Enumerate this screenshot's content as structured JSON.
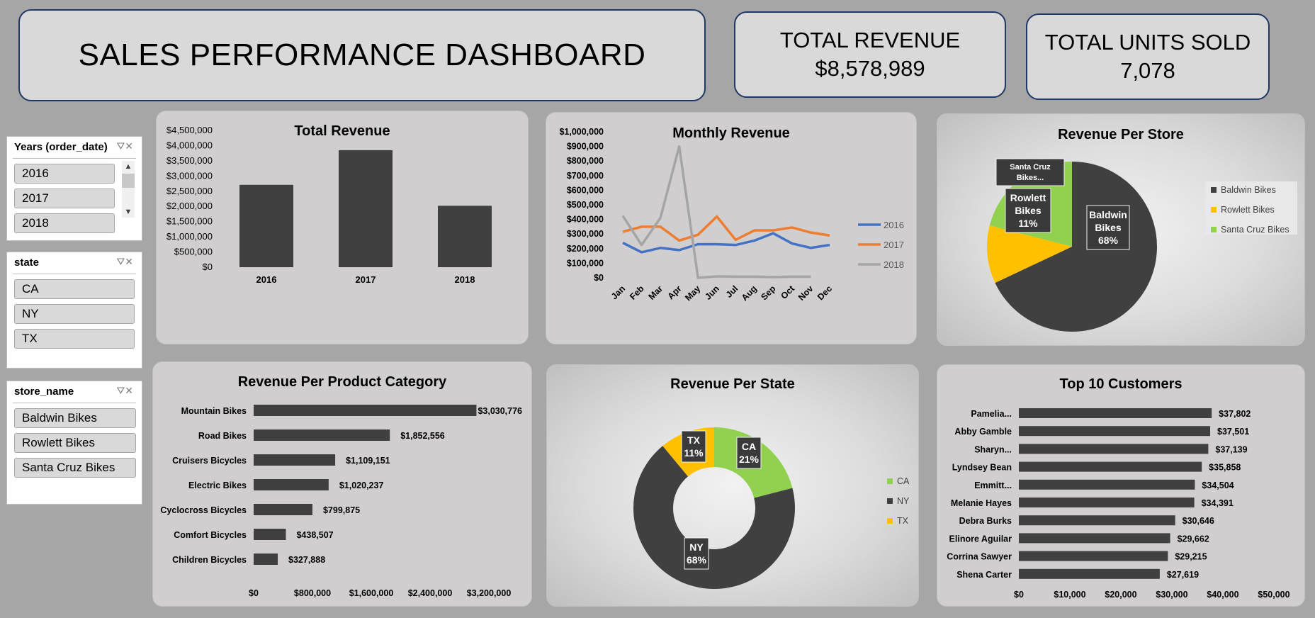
{
  "header": {
    "title": "SALES PERFORMANCE DASHBOARD",
    "kpis": [
      {
        "label": "TOTAL REVENUE",
        "value": "$8,578,989"
      },
      {
        "label": "TOTAL UNITS SOLD",
        "value": "7,078"
      }
    ]
  },
  "slicers": {
    "years": {
      "title": "Years (order_date)",
      "items": [
        "2016",
        "2017",
        "2018"
      ]
    },
    "state": {
      "title": "state",
      "items": [
        "CA",
        "NY",
        "TX"
      ]
    },
    "store": {
      "title": "store_name",
      "items": [
        "Baldwin Bikes",
        "Rowlett Bikes",
        "Santa Cruz Bikes"
      ]
    }
  },
  "colors": {
    "dark": "#404040",
    "blue": "#4472c4",
    "orange": "#ed7d31",
    "gray": "#a5a5a5",
    "green": "#92d050",
    "yellow": "#ffc000"
  },
  "chart_data": [
    {
      "id": "total-revenue",
      "type": "bar",
      "title": "Total Revenue",
      "categories": [
        "2016",
        "2017",
        "2018"
      ],
      "values": [
        2710000,
        3850000,
        2020000
      ],
      "ylim": [
        0,
        4500000
      ],
      "yticks": [
        "$0",
        "$500,000",
        "$1,000,000",
        "$1,500,000",
        "$2,000,000",
        "$2,500,000",
        "$3,000,000",
        "$3,500,000",
        "$4,000,000",
        "$4,500,000"
      ],
      "grid": false
    },
    {
      "id": "monthly-revenue",
      "type": "line",
      "title": "Monthly Revenue",
      "categories": [
        "Jan",
        "Feb",
        "Mar",
        "Apr",
        "May",
        "Jun",
        "Jul",
        "Aug",
        "Sep",
        "Oct",
        "Nov",
        "Dec"
      ],
      "series": [
        {
          "name": "2016",
          "values": [
            240000,
            175000,
            205000,
            190000,
            230000,
            230000,
            225000,
            255000,
            305000,
            235000,
            205000,
            225000
          ]
        },
        {
          "name": "2017",
          "values": [
            315000,
            350000,
            350000,
            255000,
            295000,
            420000,
            260000,
            325000,
            325000,
            345000,
            310000,
            290000
          ]
        },
        {
          "name": "2018",
          "values": [
            425000,
            225000,
            410000,
            900000,
            0,
            10000,
            8000,
            8000,
            5000,
            8000,
            8000,
            null
          ]
        }
      ],
      "ylim": [
        0,
        1000000
      ],
      "yticks": [
        "$0",
        "$100,000",
        "$200,000",
        "$300,000",
        "$400,000",
        "$500,000",
        "$600,000",
        "$700,000",
        "$800,000",
        "$900,000",
        "$1,000,000"
      ],
      "legend": "right"
    },
    {
      "id": "revenue-per-store",
      "type": "pie",
      "title": "Revenue Per Store",
      "labels": [
        "Baldwin Bikes",
        "Rowlett Bikes",
        "Santa Cruz Bikes"
      ],
      "values": [
        68,
        11,
        21
      ],
      "data_labels": [
        {
          "line1": "Baldwin",
          "line2": "Bikes",
          "line3": "68%"
        },
        {
          "line1": "Rowlett",
          "line2": "Bikes",
          "line3": "11%"
        },
        {
          "line1": "Santa Cruz",
          "line2": "Bikes..."
        }
      ],
      "legend": "right"
    },
    {
      "id": "revenue-per-category",
      "type": "bar",
      "orientation": "horizontal",
      "title": "Revenue Per Product Category",
      "categories": [
        "Mountain Bikes",
        "Road Bikes",
        "Cruisers Bicycles",
        "Electric Bikes",
        "Cyclocross Bicycles",
        "Comfort Bicycles",
        "Children Bicycles"
      ],
      "values": [
        3030776,
        1852556,
        1109151,
        1020237,
        799875,
        438507,
        327888
      ],
      "value_labels": [
        "$3,030,776",
        "$1,852,556",
        "$1,109,151",
        "$1,020,237",
        "$799,875",
        "$438,507",
        "$327,888"
      ],
      "xlim": [
        0,
        3200000
      ],
      "xticks": [
        "$0",
        "$800,000",
        "$1,600,000",
        "$2,400,000",
        "$3,200,000"
      ]
    },
    {
      "id": "revenue-per-state",
      "type": "pie",
      "subtype": "donut",
      "title": "Revenue Per State",
      "labels": [
        "CA",
        "NY",
        "TX"
      ],
      "values": [
        21,
        68,
        11
      ],
      "data_labels": [
        {
          "line1": "CA",
          "line2": "21%"
        },
        {
          "line1": "NY",
          "line2": "68%"
        },
        {
          "line1": "TX",
          "line2": "11%"
        }
      ],
      "legend": "right"
    },
    {
      "id": "top-10-customers",
      "type": "bar",
      "orientation": "horizontal",
      "title": "Top 10 Customers",
      "categories": [
        "Pamelia...",
        "Abby Gamble",
        "Sharyn...",
        "Lyndsey Bean",
        "Emmitt...",
        "Melanie Hayes",
        "Debra Burks",
        "Elinore Aguilar",
        "Corrina Sawyer",
        "Shena Carter"
      ],
      "values": [
        37802,
        37501,
        37139,
        35858,
        34504,
        34391,
        30646,
        29662,
        29215,
        27619
      ],
      "value_labels": [
        "$37,802",
        "$37,501",
        "$37,139",
        "$35,858",
        "$34,504",
        "$34,391",
        "$30,646",
        "$29,662",
        "$29,215",
        "$27,619"
      ],
      "xlim": [
        0,
        50000
      ],
      "xticks": [
        "$0",
        "$10,000",
        "$20,000",
        "$30,000",
        "$40,000",
        "$50,000"
      ]
    }
  ]
}
